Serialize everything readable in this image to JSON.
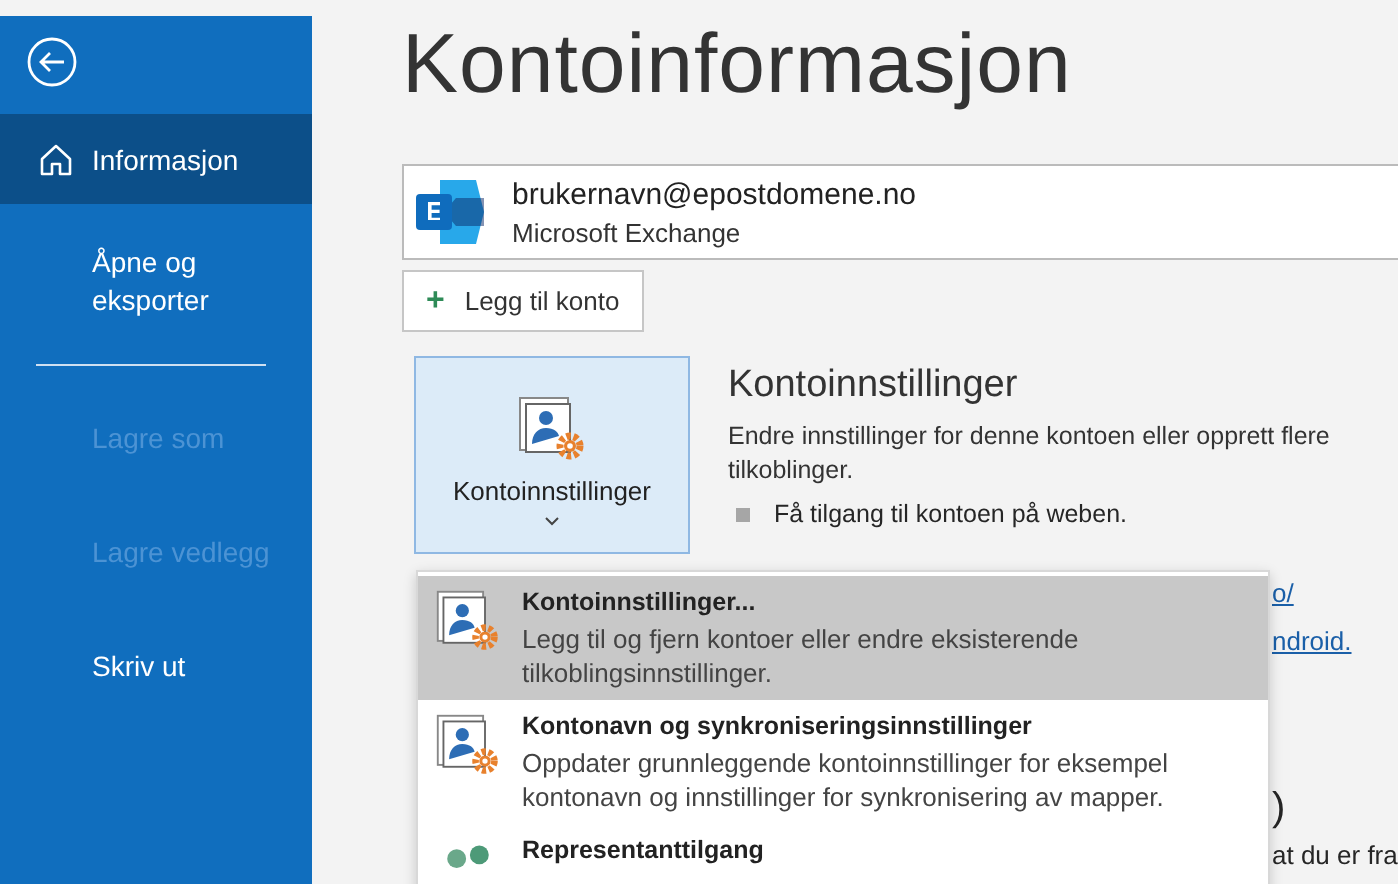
{
  "sidebar": {
    "items": [
      {
        "kind": "item",
        "label": "Informasjon",
        "selected": true,
        "disabled": false
      },
      {
        "kind": "item",
        "label": "Åpne og eksporter",
        "selected": false,
        "disabled": false
      },
      {
        "kind": "divider"
      },
      {
        "kind": "item",
        "label": "Lagre som",
        "selected": false,
        "disabled": true
      },
      {
        "kind": "item",
        "label": "Lagre vedlegg",
        "selected": false,
        "disabled": true
      },
      {
        "kind": "item",
        "label": "Skriv ut",
        "selected": false,
        "disabled": false
      }
    ]
  },
  "main": {
    "title": "Kontoinformasjon",
    "account": {
      "email": "brukernavn@epostdomene.no",
      "type": "Microsoft Exchange"
    },
    "add_account_button": {
      "icon": "+",
      "label": "Legg til konto"
    },
    "settings_button": {
      "label": "Kontoinnstillinger",
      "expanded": true
    },
    "settings_section": {
      "heading": "Kontoinnstillinger",
      "description": "Endre innstillinger for denne kontoen eller opprett flere tilkoblinger.",
      "bullets": [
        "Få tilgang til kontoen på weben."
      ]
    },
    "partly_hidden_texts": [
      {
        "kind": "link",
        "text": "o/"
      },
      {
        "kind": "link",
        "text": "ndroid."
      },
      {
        "kind": "heading",
        "text": ")"
      },
      {
        "kind": "text",
        "text": "at du er fra"
      }
    ]
  },
  "dropdown": {
    "items": [
      {
        "title": "Kontoinnstillinger...",
        "description": "Legg til og fjern kontoer eller endre eksisterende tilkoblingsinnstillinger.",
        "selected": true
      },
      {
        "title": "Kontonavn og synkroniseringsinnstillinger",
        "description": "Oppdater grunnleggende kontoinnstillinger for eksempel kontonavn og innstillinger for synkronisering av mapper.",
        "selected": false
      },
      {
        "title": "Representanttilgang",
        "selected": false
      }
    ]
  }
}
